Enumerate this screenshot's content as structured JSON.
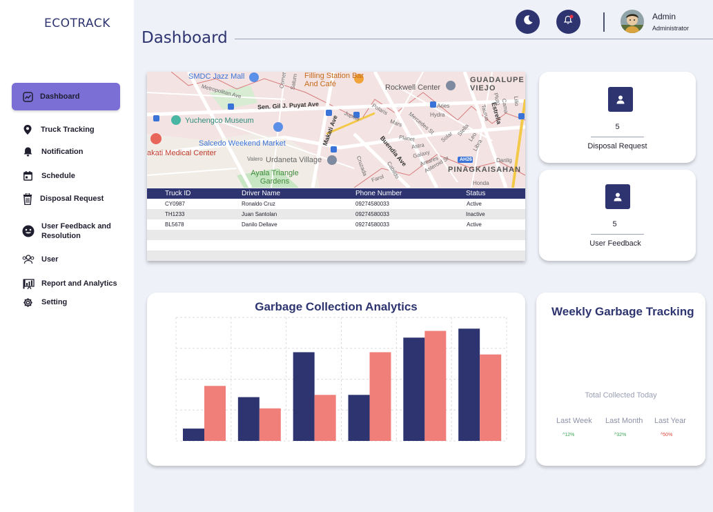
{
  "brand": "ECOTRACK",
  "page_title": "Dashboard",
  "sidebar": {
    "items": [
      {
        "label": "Dashboard",
        "icon": "dashboard-icon",
        "active": true
      },
      {
        "label": "Truck Tracking",
        "icon": "location-pin-icon"
      },
      {
        "label": "Notification",
        "icon": "bell-icon"
      },
      {
        "label": "Schedule",
        "icon": "calendar-icon"
      },
      {
        "label": "Disposal Request",
        "icon": "trash-bin-icon"
      },
      {
        "label": "User Feedback and Resolution",
        "icon": "smiley-icon"
      },
      {
        "label": "User",
        "icon": "users-icon"
      },
      {
        "label": "Report and Analytics",
        "icon": "report-icon"
      },
      {
        "label": "Setting",
        "icon": "gear-icon"
      }
    ]
  },
  "header": {
    "theme_icon": "moon-icon",
    "notification_icon": "bell-icon",
    "user_name": "Admin",
    "user_role": "Administrator"
  },
  "map": {
    "labels": [
      "SMDC Jazz Mall",
      "Filling Station Bar And Café",
      "Rockwell Center",
      "GUADALUPE VIEJO",
      "Sen. Gil J. Puyat Ave",
      "Yuchengco Museum",
      "Salcedo Weekend Market",
      "akati Medical Center",
      "Urdaneta Village",
      "Ayala Triangle Gardens",
      "PINAGKAISAHAN",
      "Makati Ave",
      "Buendia Ave",
      "Metropolitan Ave",
      "Estrella",
      "Jupiter",
      "Polaris",
      "Mars",
      "Mercedes St",
      "Planet",
      "Astra",
      "Galaxy",
      "Antares",
      "Asteroid St",
      "Aries",
      "Hydra",
      "Solar",
      "Stella",
      "Leo",
      "Libra",
      "Taurus",
      "Pluto",
      "Cama",
      "Lilio",
      "Danlig",
      "Honda",
      "Valero",
      "Cruzada",
      "Cabildo",
      "Farol",
      "Comet",
      "Saturn",
      "AH26"
    ]
  },
  "truck_table": {
    "headers": [
      "Truck ID",
      "Driver Name",
      "Phone Number",
      "Status"
    ],
    "rows": [
      [
        "CY0987",
        "Ronaldo Cruz",
        "09274580033",
        "Active"
      ],
      [
        "TH1233",
        "Juan Santolan",
        "09274580033",
        "Inactive"
      ],
      [
        "BL5678",
        "Danilo Dellave",
        "09274580033",
        "Active"
      ]
    ]
  },
  "stats": [
    {
      "value": "5",
      "label": "Disposal Request",
      "icon": "user-badge-icon"
    },
    {
      "value": "5",
      "label": "User Feedback",
      "icon": "user-badge-icon"
    }
  ],
  "chart_data": {
    "type": "bar",
    "title": "Garbage Collection Analytics",
    "categories": [
      "",
      "",
      "",
      "",
      "",
      ""
    ],
    "series": [
      {
        "values": [
          1.1,
          3.9,
          7.9,
          4.1,
          9.2,
          10.0
        ],
        "color": "#2d3470"
      },
      {
        "values": [
          4.9,
          2.9,
          4.1,
          7.9,
          9.8,
          7.7
        ],
        "color": "#f07f79"
      }
    ],
    "ylim": [
      0,
      11
    ],
    "grid": true
  },
  "weekly": {
    "title": "Weekly Garbage Tracking",
    "total_label": "Total Collected Today",
    "periods": [
      {
        "label": "Last Week",
        "change": "^12%",
        "color": "#3aa655"
      },
      {
        "label": "Last Month",
        "change": "^32%",
        "color": "#3aa655"
      },
      {
        "label": "Last Year",
        "change": "^50%",
        "color": "#e0453a"
      }
    ]
  }
}
